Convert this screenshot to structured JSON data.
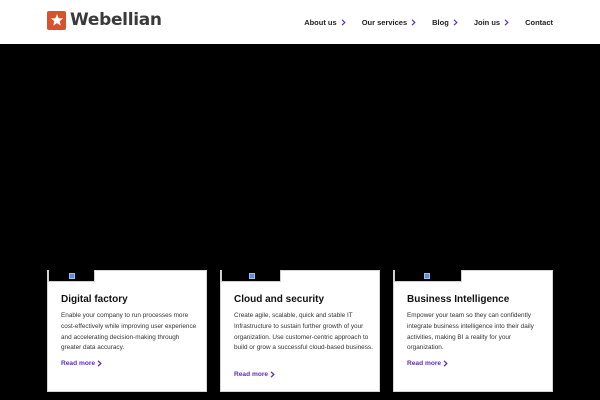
{
  "header": {
    "logo_text": "Webellian",
    "logo_icon": "star-icon",
    "nav": [
      {
        "label": "About us",
        "has_chevron": true
      },
      {
        "label": "Our services",
        "has_chevron": true
      },
      {
        "label": "Blog",
        "has_chevron": true
      },
      {
        "label": "Join us",
        "has_chevron": true
      },
      {
        "label": "Contact",
        "has_chevron": false
      }
    ]
  },
  "colors": {
    "accent": "#5e2dbd",
    "logo": "#d8532b",
    "hero_bg": "#000000",
    "card_bg": "#ffffff"
  },
  "cards": [
    {
      "title": "Digital factory",
      "text": "Enable your company to run processes more cost-effectively while improving user experience and accelerating decision-making through greater data accuracy.",
      "link": "Read more"
    },
    {
      "title": "Cloud and security",
      "text": "Create agile, scalable, quick and stable IT Infrastructure to sustain further growth of your organization. Use customer-centric approach to build or grow a successful cloud-based business.",
      "link": "Read more"
    },
    {
      "title": "Business Intelligence",
      "text": "Empower your team so they can confidently integrate business intelligence into their daily activities, making BI a reality for your organization.",
      "link": "Read more"
    }
  ]
}
